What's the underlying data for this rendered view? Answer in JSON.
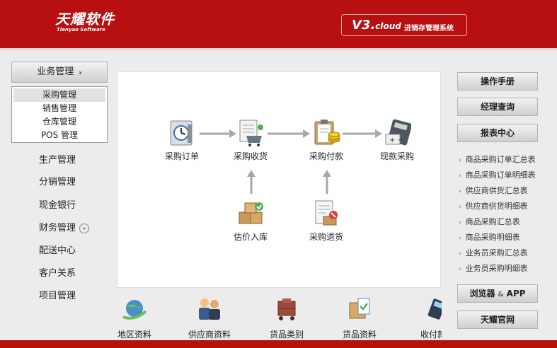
{
  "header": {
    "logo_cn": "天耀软件",
    "logo_en": "Tianyao Software",
    "version_main": "V3.",
    "version_sub": "cloud",
    "system_name": "进销存管理系统"
  },
  "leftnav": {
    "business_label": "业务管理",
    "business_chevron": "»",
    "submenu": [
      "采购管理",
      "销售管理",
      "仓库管理",
      "POS 管理"
    ],
    "items": [
      "生产管理",
      "分销管理",
      "现金银行",
      "财务管理",
      "配送中心",
      "客户关系",
      "项目管理"
    ],
    "finance_chevron": "»"
  },
  "flow": {
    "purchase_order": "采购订单",
    "purchase_receive": "采购收货",
    "purchase_pay": "采购付款",
    "cash_purchase": "现款采购",
    "estimate_instock": "估价入库",
    "purchase_return": "采购退货"
  },
  "bottom": [
    "地区资料",
    "供应商资料",
    "货品类别",
    "货品资料",
    "收付款"
  ],
  "right": {
    "manual": "操作手册",
    "manager_query": "经理查询",
    "report_center": "报表中心",
    "reports": [
      "商品采购订单汇总表",
      "商品采购订单明细表",
      "供应商供货汇总表",
      "供应商供货明细表",
      "商品采购汇总表",
      "商品采购明细表",
      "业务员采购汇总表",
      "业务员采购明细表"
    ],
    "browser_a": "浏览器",
    "browser_amp": "&",
    "browser_b": "APP",
    "official_site": "天耀官网"
  },
  "colors": {
    "brand_red": "#b80f10"
  }
}
